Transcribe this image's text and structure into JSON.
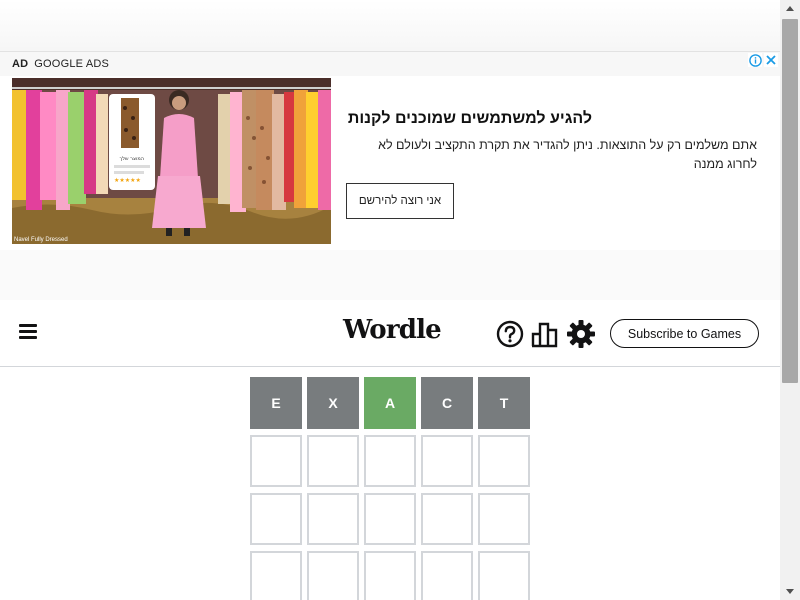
{
  "ad": {
    "label_bold": "AD",
    "label": "GOOGLE ADS",
    "choices_icon": "info-icon",
    "close_icon": "close-icon",
    "image_caption": "Navel Fully Dressed",
    "image_tag_text": "המוצר שלך",
    "headline": "להגיע למשתמשים שמוכנים לקנות",
    "body": "אתם משלמים רק על התוצאות. ניתן להגדיר את תקרת התקציב ולעולם לא לחרוג ממנה",
    "cta": "אני רוצה להירשם"
  },
  "header": {
    "title": "Wordle",
    "menu_icon": "hamburger-icon",
    "help_icon": "help-icon",
    "stats_icon": "stats-icon",
    "settings_icon": "gear-icon",
    "subscribe_label": "Subscribe to Games"
  },
  "board": {
    "rows": [
      [
        {
          "letter": "E",
          "state": "absent"
        },
        {
          "letter": "X",
          "state": "absent"
        },
        {
          "letter": "A",
          "state": "correct"
        },
        {
          "letter": "C",
          "state": "absent"
        },
        {
          "letter": "T",
          "state": "absent"
        }
      ],
      [
        {
          "letter": "",
          "state": "empty"
        },
        {
          "letter": "",
          "state": "empty"
        },
        {
          "letter": "",
          "state": "empty"
        },
        {
          "letter": "",
          "state": "empty"
        },
        {
          "letter": "",
          "state": "empty"
        }
      ],
      [
        {
          "letter": "",
          "state": "empty"
        },
        {
          "letter": "",
          "state": "empty"
        },
        {
          "letter": "",
          "state": "empty"
        },
        {
          "letter": "",
          "state": "empty"
        },
        {
          "letter": "",
          "state": "empty"
        }
      ],
      [
        {
          "letter": "",
          "state": "empty"
        },
        {
          "letter": "",
          "state": "empty"
        },
        {
          "letter": "",
          "state": "empty"
        },
        {
          "letter": "",
          "state": "empty"
        },
        {
          "letter": "",
          "state": "empty"
        }
      ]
    ]
  },
  "colors": {
    "correct": "#6aaa64",
    "absent": "#787c7e",
    "empty_border": "#d3d6da"
  }
}
